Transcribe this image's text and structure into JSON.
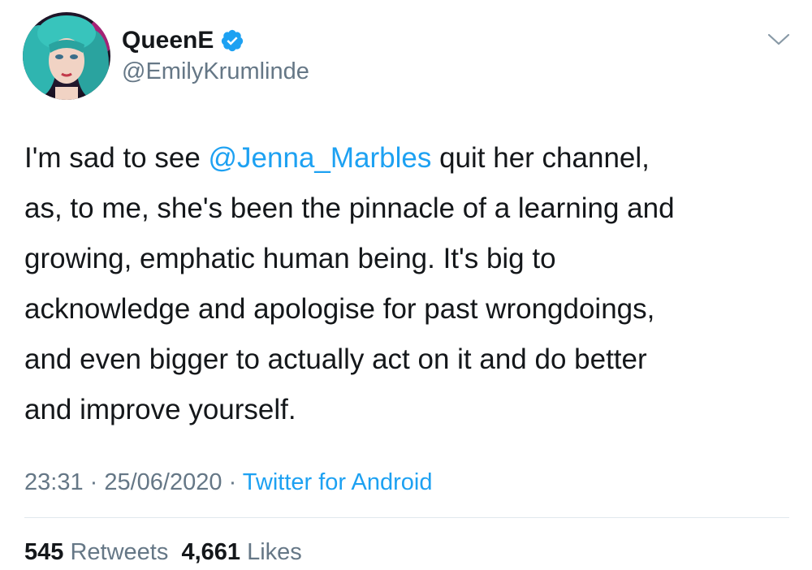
{
  "user": {
    "display_name": "QueenE",
    "handle": "@EmilyKrumlinde",
    "verified": true
  },
  "icons": {
    "verified": "verified-badge-icon",
    "menu": "chevron-down-icon"
  },
  "colors": {
    "link": "#1da1f2",
    "text": "#14171a",
    "secondary": "#657786"
  },
  "tweet": {
    "lines": [
      {
        "before": "I'm sad to see ",
        "mention": "@Jenna_Marbles",
        "after": " quit her channel,"
      },
      {
        "text": "as, to me, she's been the pinnacle of a learning and"
      },
      {
        "text": "growing, emphatic human being. It's big to"
      },
      {
        "text": "acknowledge and apologise for past wrongdoings,"
      },
      {
        "text": "and even bigger to actually act on it and do better"
      },
      {
        "text": "and improve yourself."
      }
    ]
  },
  "meta": {
    "time": "23:31",
    "separator": " · ",
    "date": "25/06/2020",
    "source": "Twitter for Android"
  },
  "stats": {
    "retweets_count": "545",
    "retweets_label": "Retweets",
    "likes_count": "4,661",
    "likes_label": "Likes"
  }
}
